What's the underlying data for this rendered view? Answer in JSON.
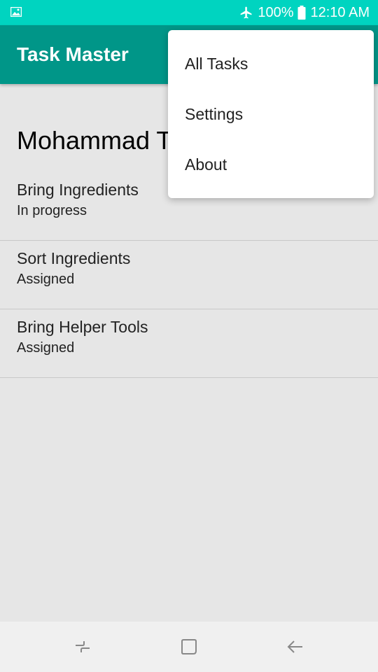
{
  "status_bar": {
    "battery": "100%",
    "time": "12:10 AM"
  },
  "app_bar": {
    "title": "Task Master"
  },
  "user": {
    "name": "Mohammad T"
  },
  "tasks": [
    {
      "title": "Bring Ingredients",
      "status": "In progress"
    },
    {
      "title": "Sort Ingredients",
      "status": "Assigned"
    },
    {
      "title": "Bring Helper Tools",
      "status": "Assigned"
    }
  ],
  "menu": {
    "items": [
      "All Tasks",
      "Settings",
      "About"
    ]
  },
  "icons": {
    "status_left": "gallery-icon",
    "airplane": "airplane-icon",
    "battery": "battery-icon",
    "nav_recents": "recents-icon",
    "nav_home": "home-icon",
    "nav_back": "back-icon"
  },
  "colors": {
    "status_bar": "#00d4c0",
    "app_bar": "#009688",
    "background": "#e6e6e6"
  }
}
